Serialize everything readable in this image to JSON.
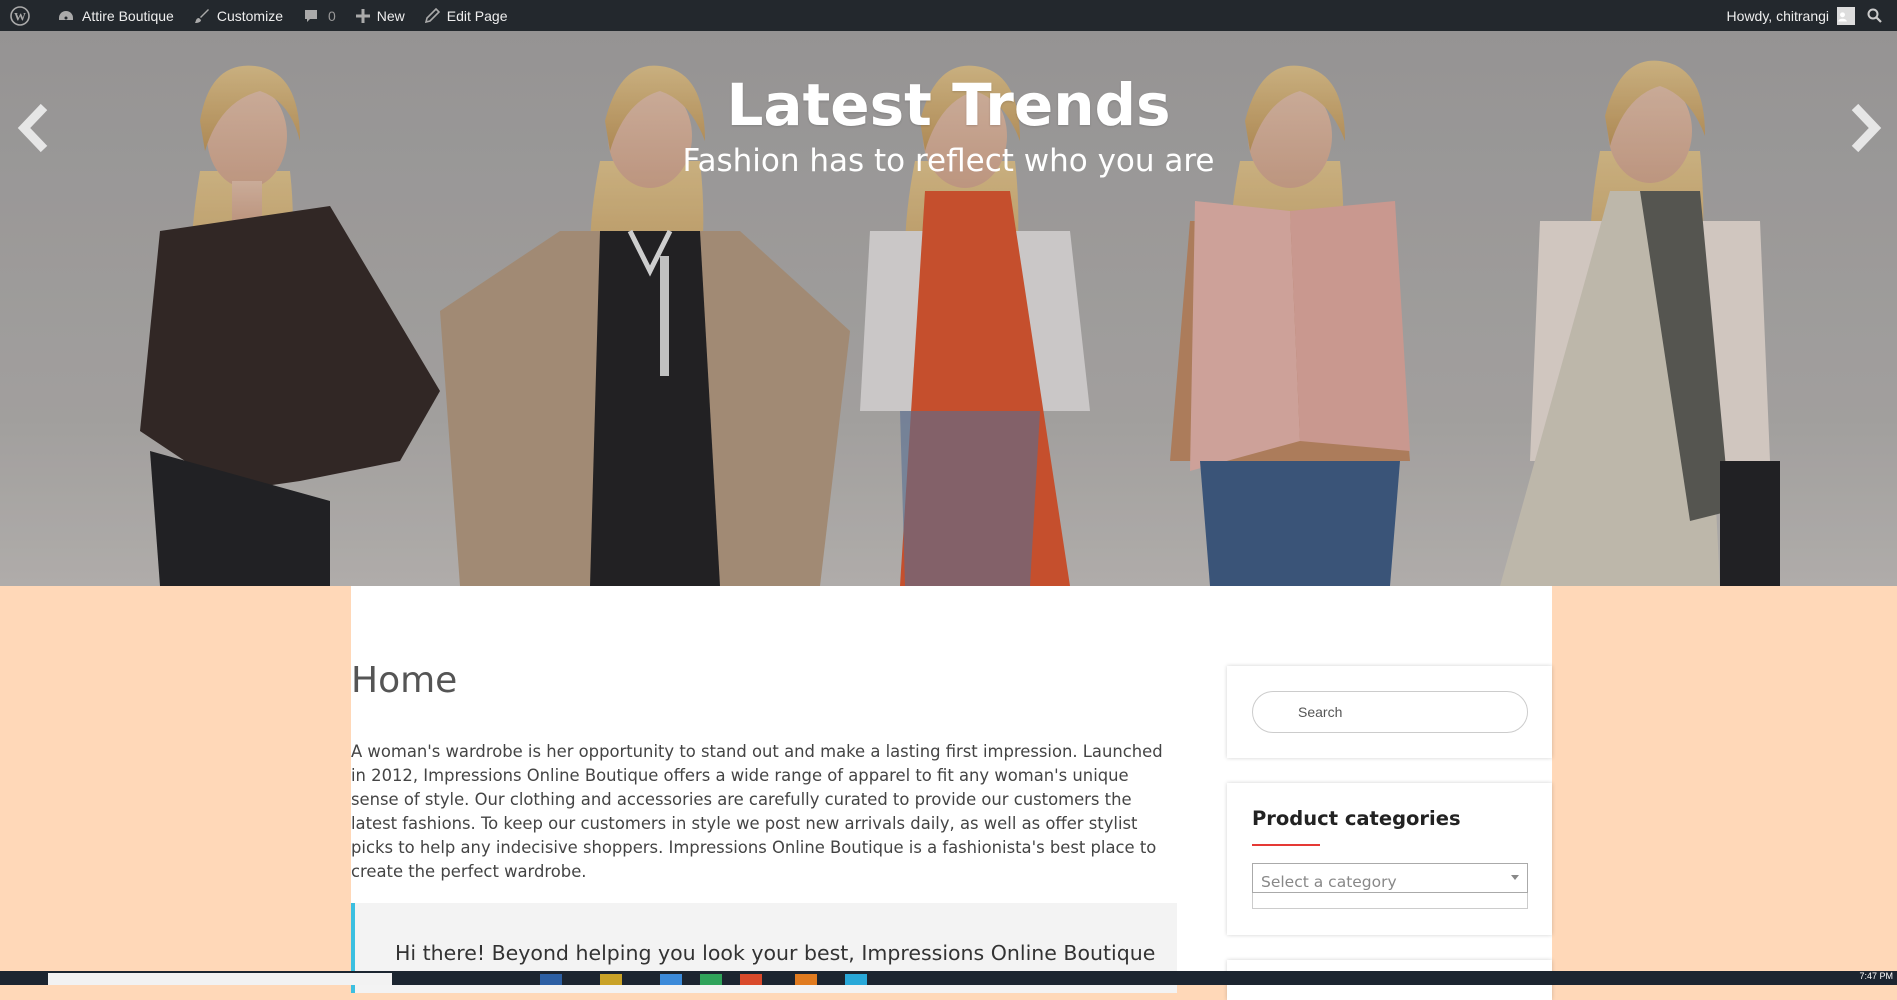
{
  "admin_bar": {
    "site_name": "Attire Boutique",
    "customize_label": "Customize",
    "comments_count": "0",
    "new_label": "New",
    "edit_page_label": "Edit Page",
    "howdy": "Howdy, chitrangi"
  },
  "hero": {
    "title": "Latest Trends",
    "subtitle": "Fashion has to reflect who you are"
  },
  "page": {
    "title": "Home",
    "body": "A woman's wardrobe is her opportunity to stand out and make a lasting first impression. Launched in 2012, Impressions Online Boutique offers a wide range of apparel to fit any woman's unique sense of style. Our clothing and accessories are carefully curated to provide our customers the latest fashions. To keep our customers in style we post new arrivals daily, as well as offer stylist picks to help any indecisive shoppers. Impressions Online Boutique is a fashionista's best place to create the perfect wardrobe.",
    "quote": "Hi there! Beyond helping you look your best, Impressions Online Boutique"
  },
  "sidebar": {
    "search_placeholder": "Search",
    "categories_title": "Product categories",
    "category_select": "Select a category"
  },
  "taskbar": {
    "clock": "7:47 PM"
  },
  "colors": {
    "admin_bar_bg": "#23282d",
    "page_bg": "#ffd8b8",
    "quote_border": "#3cbfe0",
    "widget_underline": "#e53935"
  }
}
